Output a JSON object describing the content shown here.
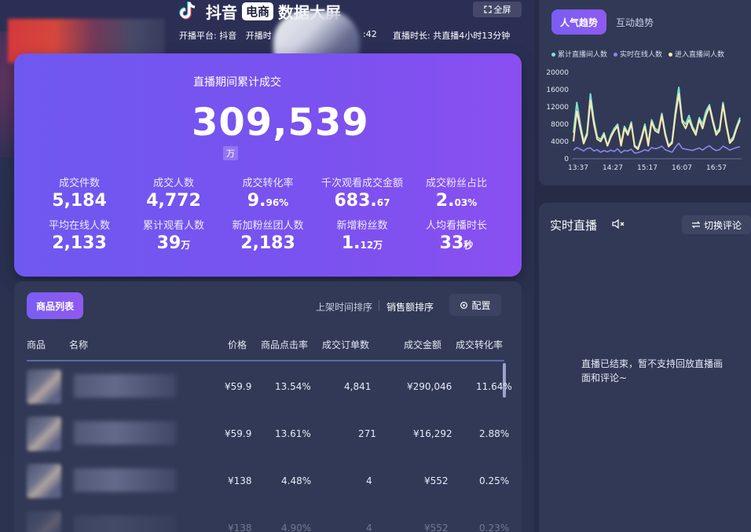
{
  "header": {
    "brand": "抖音",
    "badge": "电商",
    "title_suffix": "数据大屏",
    "fullscreen_label": "全屏",
    "platform": "开播平台: 抖音",
    "start_prefix": "开播时",
    "time_tail": ":42",
    "duration": "直播时长: 共直播4小时13分钟"
  },
  "stats": {
    "title": "直播期间累计成交",
    "total": "309,539",
    "total_unit": "万",
    "metrics": [
      {
        "label": "成交件数",
        "value": "5,184",
        "suffix": ""
      },
      {
        "label": "成交人数",
        "value": "4,772",
        "suffix": ""
      },
      {
        "label": "成交转化率",
        "value": "9.",
        "suffix": "96%"
      },
      {
        "label": "千次观看成交金额",
        "value": "683.",
        "suffix": "67"
      },
      {
        "label": "成交粉丝占比",
        "value": "2.",
        "suffix": "03%"
      },
      {
        "label": "平均在线人数",
        "value": "2,133",
        "suffix": ""
      },
      {
        "label": "累计观看人数",
        "value": "39",
        "suffix": "万"
      },
      {
        "label": "新加粉丝团人数",
        "value": "2,183",
        "suffix": ""
      },
      {
        "label": "新增粉丝数",
        "value": "1.",
        "suffix": "12万"
      },
      {
        "label": "人均看播时长",
        "value": "33",
        "suffix": "秒"
      }
    ]
  },
  "products": {
    "tab_label": "商品列表",
    "sort_time": "上架时间排序",
    "sort_sales": "销售额排序",
    "config_label": "配置",
    "headers": {
      "product": "商品",
      "name": "名称",
      "price": "价格",
      "ctr": "商品点击率",
      "orders": "成交订单数",
      "amount": "成交金额",
      "cvr": "成交转化率"
    },
    "rows": [
      {
        "price": "¥59.9",
        "ctr": "13.54%",
        "orders": "4,841",
        "amount": "¥290,046",
        "cvr": "11.64%"
      },
      {
        "price": "¥59.9",
        "ctr": "13.61%",
        "orders": "271",
        "amount": "¥16,292",
        "cvr": "2.88%"
      },
      {
        "price": "¥138",
        "ctr": "4.48%",
        "orders": "4",
        "amount": "¥552",
        "cvr": "0.25%"
      },
      {
        "price": "¥138",
        "ctr": "4.90%",
        "orders": "4",
        "amount": "¥552",
        "cvr": "0.23%"
      }
    ]
  },
  "trend": {
    "tab_hot": "人气趋势",
    "tab_interact": "互动趋势",
    "chart_data": {
      "type": "line",
      "x_ticks": [
        "13:37",
        "14:27",
        "15:17",
        "16:07",
        "16:57"
      ],
      "y_ticks": [
        "0",
        "4000",
        "8000",
        "12000",
        "16000",
        "20000"
      ],
      "ylim": [
        0,
        20000
      ],
      "legend": "top",
      "series": [
        {
          "name": "累计直播间人数",
          "color": "#7fe3d0",
          "values": [
            6000,
            13000,
            8000,
            4000,
            6000,
            15000,
            9000,
            5000,
            4500,
            6000,
            3000,
            5500,
            7000,
            8000,
            3500,
            7500,
            6000,
            8500,
            3000,
            2500,
            5000,
            8000,
            3500,
            9000,
            7000,
            6500,
            10500,
            6000,
            3000,
            4000,
            11000,
            16500,
            9000,
            8000,
            10000,
            7500,
            6000,
            9500,
            8000,
            11000,
            12500,
            9000,
            6000,
            7000,
            13000,
            8000,
            4000,
            5000,
            7500,
            9500
          ]
        },
        {
          "name": "实时在线人数",
          "color": "#8a86f0",
          "values": [
            2000,
            2600,
            2200,
            1800,
            2400,
            2500,
            1800,
            2100,
            1500,
            1900,
            1600,
            2000,
            1700,
            2300,
            1400,
            1900,
            1800,
            2200,
            1300,
            1400,
            1700,
            2100,
            1800,
            2600,
            2300,
            2500,
            2900,
            2100,
            1800,
            1500,
            2700,
            3600,
            2400,
            2200,
            2100,
            1900,
            2200,
            2500,
            2000,
            2600,
            3000,
            2300,
            1900,
            2100,
            2900,
            2500,
            2000,
            2300,
            2600,
            2800
          ]
        },
        {
          "name": "进入直播间人数",
          "color": "#ffe7b0",
          "values": [
            4000,
            11000,
            7000,
            3500,
            5500,
            13500,
            8000,
            4500,
            4000,
            5500,
            3000,
            5000,
            6500,
            7500,
            3000,
            7000,
            5500,
            8000,
            2800,
            2200,
            4500,
            7500,
            3000,
            8500,
            6500,
            6000,
            10000,
            5500,
            2800,
            3600,
            10000,
            15000,
            8500,
            7000,
            9000,
            7000,
            5500,
            9000,
            7000,
            10000,
            12000,
            8500,
            5500,
            6500,
            12500,
            7500,
            3600,
            4500,
            7000,
            9000
          ]
        }
      ]
    }
  },
  "live": {
    "title": "实时直播",
    "switch_label": "切换评论",
    "message": "直播已结束，暂不支持回放直播画面和评论~"
  }
}
